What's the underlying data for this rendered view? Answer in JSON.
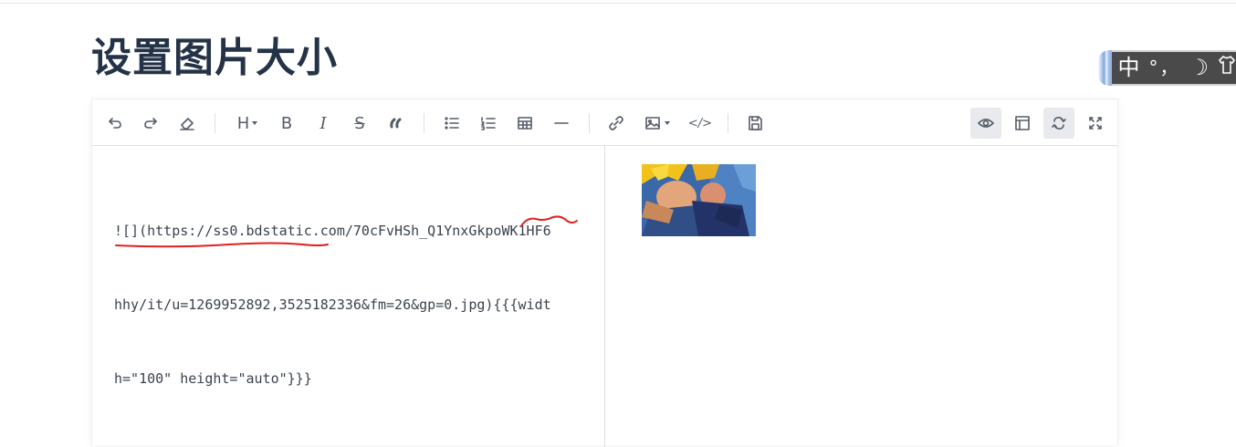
{
  "page": {
    "title": "设置图片大小"
  },
  "ime": {
    "mode": "中",
    "punct": "°，",
    "moon": "☽"
  },
  "toolbar": {
    "undo": "undo-icon",
    "redo": "redo-icon",
    "clear": "eraser-icon",
    "heading": "H",
    "bold": "B",
    "italic": "I",
    "strike": "S",
    "quote": "quote-icon",
    "ul": "bullet-list-icon",
    "ol": "ordered-list-icon",
    "table": "table-icon",
    "hr": "hr-icon",
    "link": "link-icon",
    "image": "image-icon",
    "code": "</>",
    "save": "save-icon",
    "preview": "eye-icon",
    "layout": "layout-icon",
    "sync": "sync-icon",
    "fullscreen": "fullscreen-icon"
  },
  "editor": {
    "lines": [
      "![](https://ss0.bdstatic.com/70cFvHSh_Q1YnxGkpoWK1HF6",
      "hhy/it/u=1269952892,3525182336&fm=26&gp=0.jpg){{{widt",
      "h=\"100\" height=\"auto\"}}}"
    ]
  },
  "colors": {
    "annotation": "#e02020",
    "title": "#243347",
    "active_bg": "#e8eaed"
  }
}
